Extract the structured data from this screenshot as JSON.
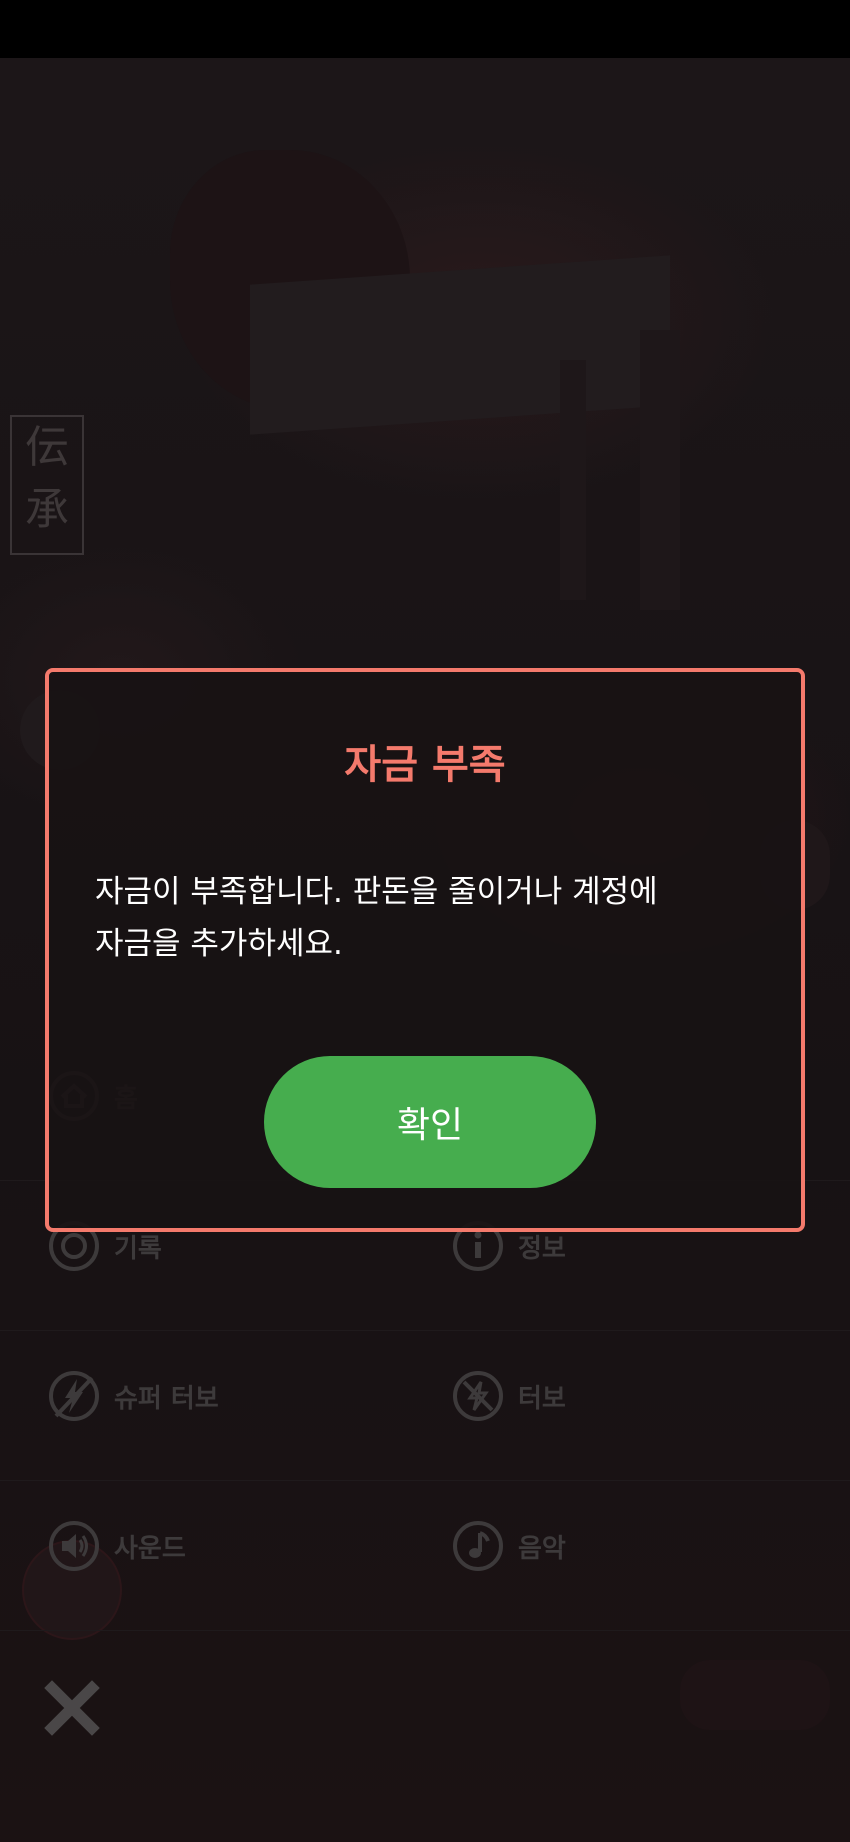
{
  "background": {
    "sign_chars": [
      "伝",
      "承"
    ]
  },
  "menu": {
    "home_label": "홈",
    "history_label": "기록",
    "info_label": "정보",
    "super_turbo_label": "슈퍼 터보",
    "turbo_label": "터보",
    "sound_label": "사운드",
    "music_label": "음악"
  },
  "dialog": {
    "title": "자금 부족",
    "message": "자금이 부족합니다. 판돈을 줄이거나 계정에 자금을 추가하세요.",
    "confirm_label": "확인"
  },
  "colors": {
    "accent": "#f47a6c",
    "confirm": "#46ad4e"
  }
}
